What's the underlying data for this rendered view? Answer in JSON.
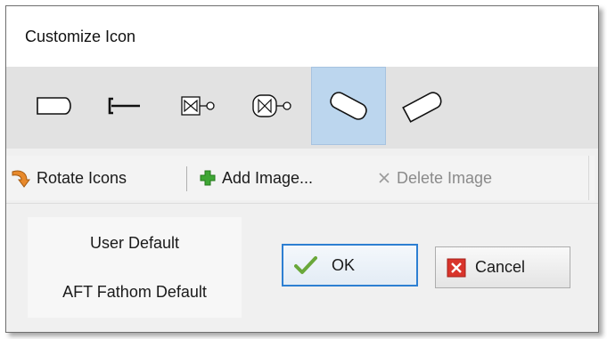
{
  "dialog": {
    "title": "Customize Icon"
  },
  "icon_strip": {
    "icons": [
      {
        "name": "rounded-rectangle-icon",
        "selected": false
      },
      {
        "name": "bracket-line-icon",
        "selected": false
      },
      {
        "name": "valve-actuator-icon",
        "selected": false
      },
      {
        "name": "round-valve-actuator-icon",
        "selected": false
      },
      {
        "name": "tilted-capsule-icon",
        "selected": true
      },
      {
        "name": "tilted-tag-icon",
        "selected": false
      }
    ]
  },
  "toolbar": {
    "rotate_label": "Rotate Icons",
    "add_label": "Add Image...",
    "delete_label": "Delete Image",
    "delete_enabled": false
  },
  "defaults": {
    "user_default": "User Default",
    "aft_default": "AFT Fathom Default"
  },
  "buttons": {
    "ok_label": "OK",
    "cancel_label": "Cancel"
  },
  "colors": {
    "selected_tile": "#bcd6ee",
    "ok_border": "#2d7fd2",
    "add_green": "#3ea634",
    "cancel_red": "#d9342b",
    "rotate_orange": "#e8892b"
  }
}
